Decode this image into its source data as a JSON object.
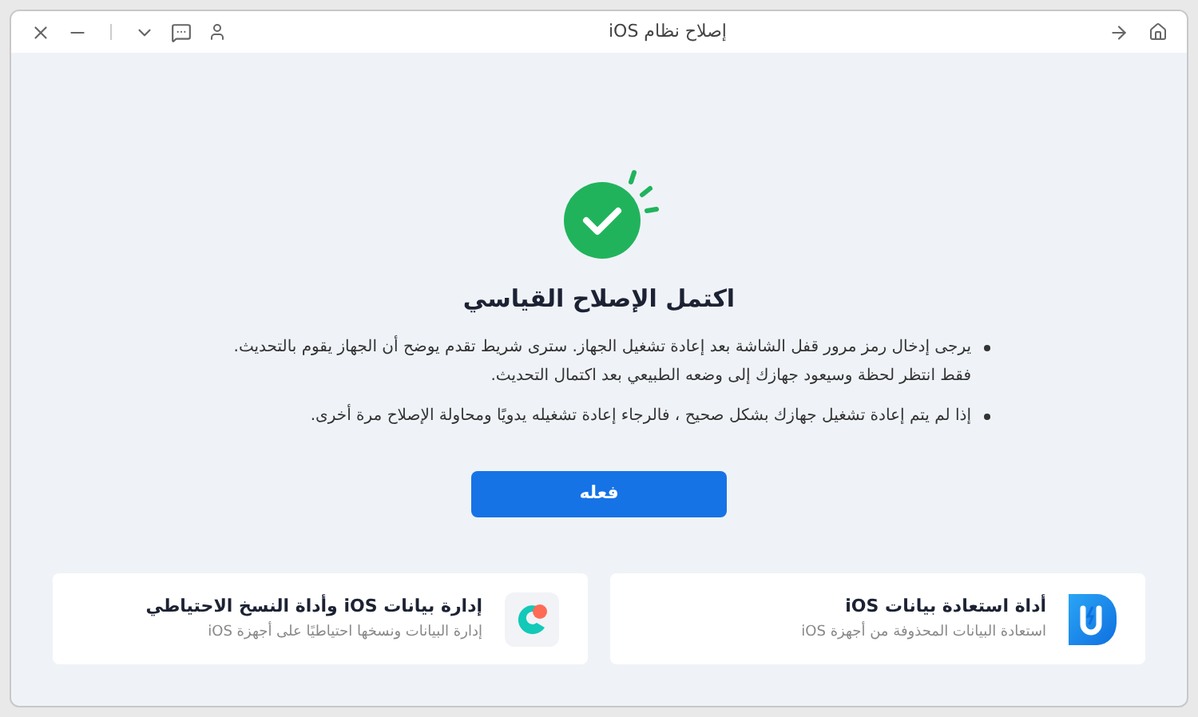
{
  "window": {
    "title": "إصلاح نظام iOS"
  },
  "result": {
    "title": "اكتمل الإصلاح القياسي",
    "notes": [
      "يرجى إدخال رمز مرور قفل الشاشة بعد إعادة تشغيل الجهاز. سترى شريط تقدم يوضح أن الجهاز يقوم بالتحديث. فقط انتظر لحظة وسيعود جهازك إلى وضعه الطبيعي بعد اكتمال التحديث.",
      "إذا لم يتم إعادة تشغيل جهازك بشكل صحيح ، فالرجاء إعادة تشغيله يدويًا ومحاولة الإصلاح مرة أخرى."
    ],
    "button": "فعله"
  },
  "products": [
    {
      "kind": "recovery",
      "title": "أداة استعادة بيانات iOS",
      "subtitle": "استعادة البيانات المحذوفة من أجهزة iOS"
    },
    {
      "kind": "manager",
      "title": "إدارة بيانات iOS وأداة النسخ الاحتياطي",
      "subtitle": "إدارة البيانات ونسخها احتياطيًا على أجهزة iOS"
    }
  ]
}
